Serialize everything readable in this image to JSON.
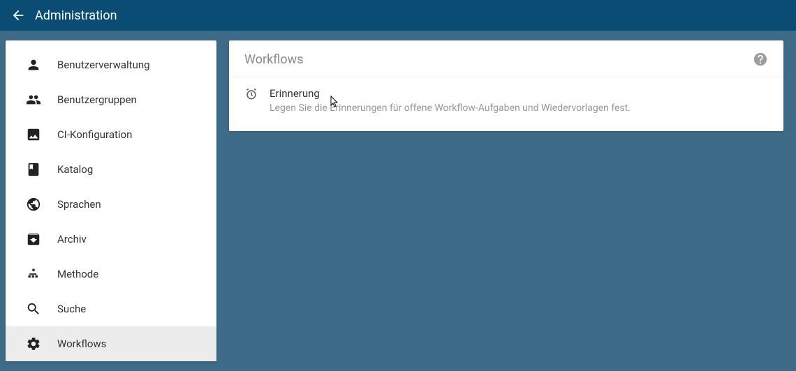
{
  "header": {
    "title": "Administration"
  },
  "sidebar": {
    "items": [
      {
        "label": "Benutzerverwaltung",
        "icon": "person",
        "active": false
      },
      {
        "label": "Benutzergruppen",
        "icon": "group",
        "active": false
      },
      {
        "label": "CI-Konfiguration",
        "icon": "image",
        "active": false
      },
      {
        "label": "Katalog",
        "icon": "book",
        "active": false
      },
      {
        "label": "Sprachen",
        "icon": "globe",
        "active": false
      },
      {
        "label": "Archiv",
        "icon": "archive",
        "active": false
      },
      {
        "label": "Methode",
        "icon": "sitemap",
        "active": false
      },
      {
        "label": "Suche",
        "icon": "search",
        "active": false
      },
      {
        "label": "Workflows",
        "icon": "gear",
        "active": true
      }
    ]
  },
  "main": {
    "title": "Workflows",
    "items": [
      {
        "title": "Erinnerung",
        "description": "Legen Sie die Erinnerungen für offene Workflow-Aufgaben und Wiedervorlagen fest."
      }
    ]
  }
}
